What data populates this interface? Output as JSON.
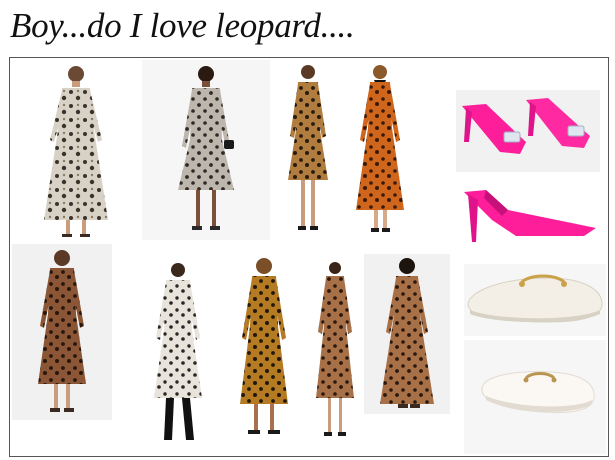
{
  "title": "Boy...do I love leopard....",
  "colors": {
    "leopard_light": "#cfc6b8",
    "leopard_warm": "#a0703a",
    "leopard_orange": "#c9651e",
    "leopard_brown": "#7a4a2e",
    "pink_shoe": "#ff1e9a",
    "loafer_cream": "#f3efe6",
    "gold_hardware": "#c9a24a",
    "frame_border": "#555555"
  },
  "items": [
    {
      "kind": "dress",
      "style": "light-leopard-maxi-wrap"
    },
    {
      "kind": "dress",
      "style": "grey-leopard-midi"
    },
    {
      "kind": "dress",
      "style": "tan-leopard-midi"
    },
    {
      "kind": "dress",
      "style": "orange-leopard-maxi-tie-neck"
    },
    {
      "kind": "shoe",
      "style": "pink-satin-mules-crystal-buckle"
    },
    {
      "kind": "shoe",
      "style": "pink-pointed-mule"
    },
    {
      "kind": "dress",
      "style": "brown-leopard-wrap-midi"
    },
    {
      "kind": "dress",
      "style": "white-leopard-wrap-midi"
    },
    {
      "kind": "dress",
      "style": "gold-leopard-shirt-dress"
    },
    {
      "kind": "dress",
      "style": "leopard-v-neck-midi"
    },
    {
      "kind": "dress",
      "style": "leopard-maxi"
    },
    {
      "kind": "shoe",
      "style": "cream-horsebit-loafer-mule"
    },
    {
      "kind": "shoe",
      "style": "white-bit-mule"
    }
  ]
}
